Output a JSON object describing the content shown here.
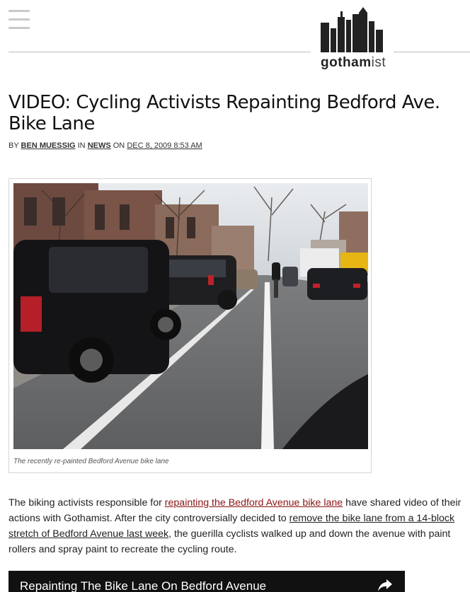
{
  "header": {
    "logo_bold": "gotham",
    "logo_light": "ist"
  },
  "article": {
    "title": "VIDEO: Cycling Activists Repainting Bedford Ave. Bike Lane",
    "byline": {
      "by": "BY",
      "author": "BEN MUESSIG",
      "in": "IN",
      "category": "NEWS",
      "on": "ON",
      "date": "DEC 8, 2009 8:53 AM"
    },
    "figure": {
      "caption": "The recently re-painted Bedford Avenue bike lane"
    },
    "paragraph": {
      "p1": "The biking activists responsible for ",
      "link1": "repainting the Bedford Avenue bike lane",
      "p2": " have shared video of their actions with Gothamist. After the city controversially decided to ",
      "link2": "remove the bike lane from a 14-block stretch of Bedford Avenue last week",
      "p3": ", the guerilla cyclists walked up and down the avenue with paint rollers and spray paint to recreate the cycling route."
    },
    "video": {
      "title": "Repainting The Bike Lane On Bedford Avenue"
    }
  },
  "colors": {
    "link": "#8b1414",
    "text": "#222222",
    "video_bg": "#111111"
  }
}
